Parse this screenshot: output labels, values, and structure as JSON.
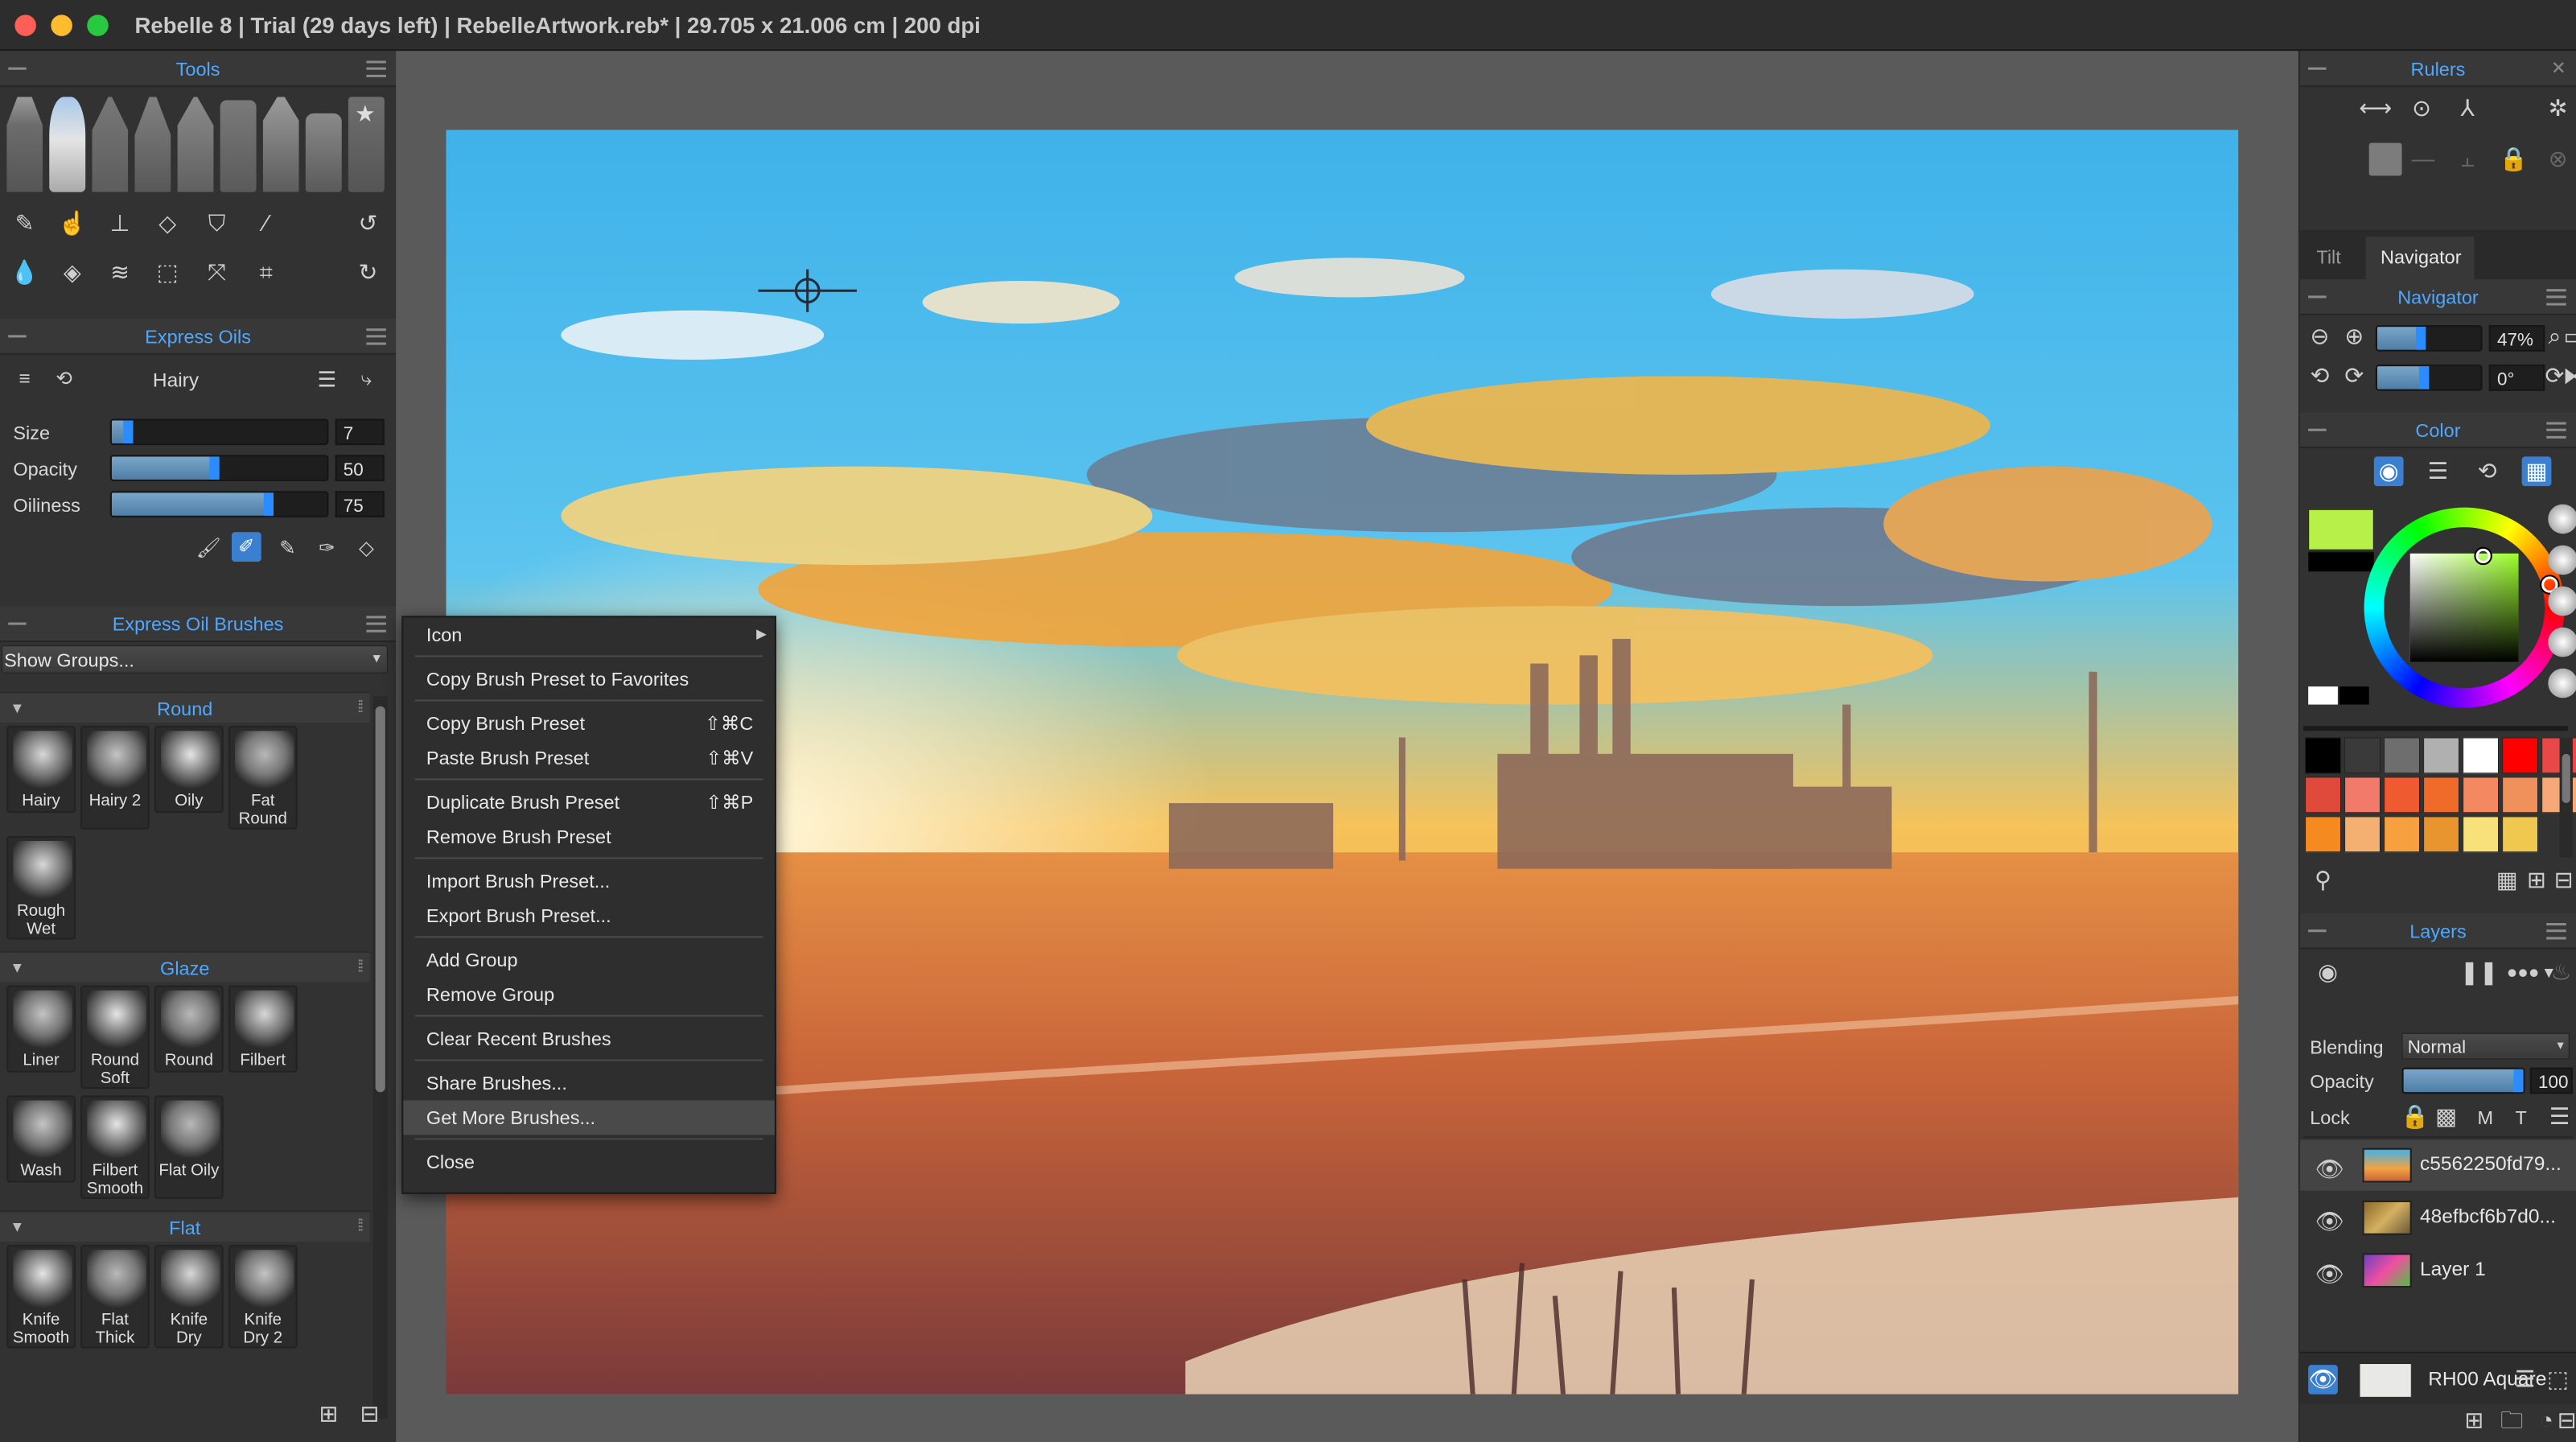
{
  "window": {
    "title": "Rebelle 8 | Trial (29 days left) | RebelleArtwork.reb* | 29.705 x 21.006 cm | 200 dpi"
  },
  "tools_panel": {
    "title": "Tools"
  },
  "brush_settings": {
    "title": "Express Oils",
    "preset": "Hairy",
    "sliders": [
      {
        "label": "Size",
        "value": "7",
        "level": 0.1
      },
      {
        "label": "Opacity",
        "value": "50",
        "level": 0.5
      },
      {
        "label": "Oiliness",
        "value": "75",
        "level": 0.75
      }
    ]
  },
  "brush_library": {
    "title": "Express Oil Brushes",
    "group_filter": "Show Groups...",
    "groups": [
      {
        "name": "Round",
        "brushes": [
          "Hairy",
          "Hairy 2",
          "Oily",
          "Fat Round",
          "Rough Wet"
        ]
      },
      {
        "name": "Glaze",
        "brushes": [
          "Liner",
          "Round Soft",
          "Round",
          "Filbert",
          "Wash",
          "Filbert Smooth",
          "Flat Oily"
        ]
      },
      {
        "name": "Flat",
        "brushes": [
          "Knife Smooth",
          "Flat Thick",
          "Knife Dry",
          "Knife Dry 2"
        ]
      }
    ]
  },
  "context_menu": {
    "items": [
      {
        "label": "Icon",
        "shortcut": "",
        "submenu": true
      },
      {
        "label": "Copy Brush Preset to Favorites",
        "shortcut": ""
      },
      {
        "label": "Copy Brush Preset",
        "shortcut": "⇧⌘C"
      },
      {
        "label": "Paste Brush Preset",
        "shortcut": "⇧⌘V"
      },
      {
        "label": "Duplicate Brush Preset",
        "shortcut": "⇧⌘P"
      },
      {
        "label": "Remove Brush Preset",
        "shortcut": ""
      },
      {
        "label": "Import Brush Preset...",
        "shortcut": ""
      },
      {
        "label": "Export Brush Preset...",
        "shortcut": ""
      },
      {
        "label": "Add Group",
        "shortcut": ""
      },
      {
        "label": "Remove Group",
        "shortcut": ""
      },
      {
        "label": "Clear Recent Brushes",
        "shortcut": ""
      },
      {
        "label": "Share Brushes...",
        "shortcut": ""
      },
      {
        "label": "Get More Brushes...",
        "shortcut": "",
        "highlighted": true
      },
      {
        "label": "Close",
        "shortcut": ""
      }
    ]
  },
  "rulers": {
    "title": "Rulers"
  },
  "tabs": {
    "tilt": "Tilt",
    "navigator": "Navigator"
  },
  "navigator": {
    "title": "Navigator",
    "zoom": "47%",
    "rotation": "0°",
    "zoom_level": 0.47,
    "rotation_level": 0.5
  },
  "color": {
    "title": "Color",
    "primary": "#b8f04a",
    "secondary": "#000000",
    "swatches": [
      "#000000",
      "#3a3a3a",
      "#6e6e6e",
      "#b0b0b0",
      "#ffffff",
      "#ff0000",
      "#e84848",
      "#e04a3a",
      "#f27a6a",
      "#f05a30",
      "#f06a2a",
      "#f48860",
      "#f0905a",
      "#f5a878",
      "#f58a20",
      "#f4b070",
      "#f6a040",
      "#e89530",
      "#f8e07a",
      "#f0c850"
    ]
  },
  "layers": {
    "title": "Layers",
    "blending_label": "Blending",
    "blending_value": "Normal",
    "opacity_label": "Opacity",
    "opacity_value": "100",
    "opacity_level": 1.0,
    "lock_label": "Lock",
    "lock_m": "M",
    "lock_t": "T",
    "items": [
      {
        "name": "c5562250fd79...",
        "selected": true
      },
      {
        "name": "48efbcf6b7d0...",
        "selected": false
      },
      {
        "name": "Layer 1",
        "selected": false
      }
    ],
    "paper": "RH00 Aquare"
  }
}
